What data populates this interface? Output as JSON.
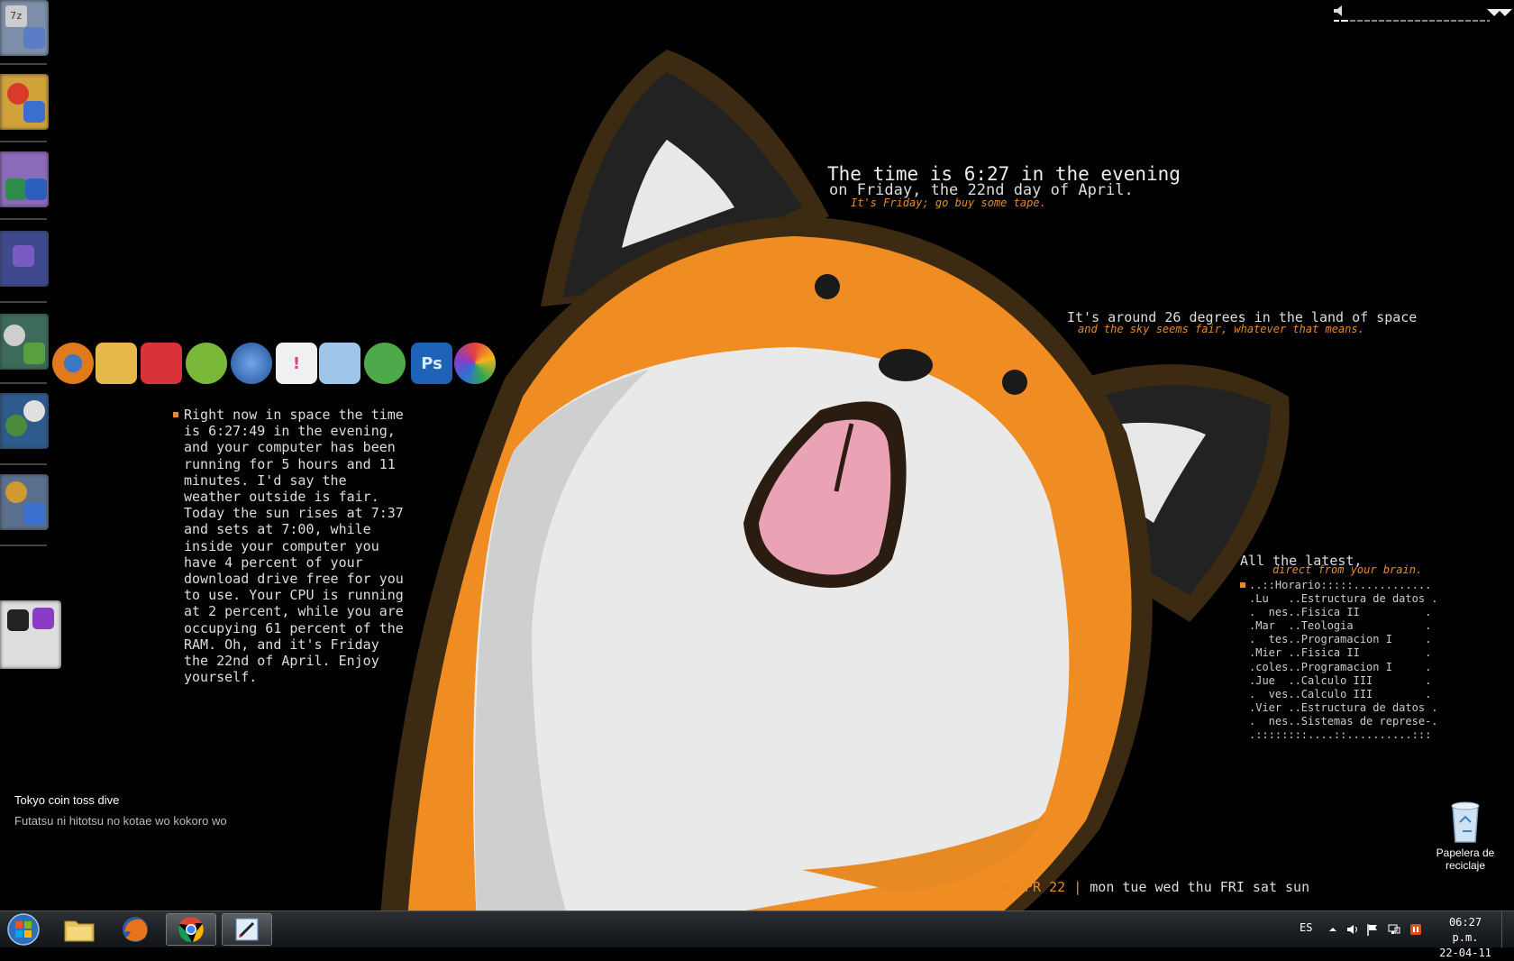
{
  "clock": {
    "line1": "The time is 6:27 in the evening",
    "line2": "on Friday, the 22nd day of April.",
    "quote": "It's Friday; go buy some tape."
  },
  "weather": {
    "line1": "It's around 26 degrees in the land of space",
    "line2": "and the sky seems fair, whatever that means."
  },
  "paragraph": "Right now in space the time is 6:27:49 in the evening, and your computer has been running for 5 hours and 11 minutes. I'd say the weather outside is fair. Today the sun rises at 7:37 and sets at 7:00, while inside your computer you have 4 percent of your download drive free for you to use. Your CPU is running at 2 percent, while you are occupying 61 percent of the RAM. Oh, and it's Friday the 22nd of April. Enjoy yourself.",
  "latest": {
    "title": "All the latest,",
    "subtitle": "direct from your brain.",
    "schedule": [
      "..::Horario:::::............",
      ".Lu   ..Estructura de datos .",
      ".  nes..Fisica II          .",
      ".Mar  ..Teologia           .",
      ".  tes..Programacion I     .",
      ".Mier ..Fisica II          .",
      ".coles..Programacion I     .",
      ".Jue  ..Calculo III        .",
      ".  ves..Calculo III        .",
      ".Vier ..Estructura de datos .",
      ".  nes..Sistemas de represe-.",
      ".::::::::....::..........:::"
    ]
  },
  "calendar": {
    "date": "APR 22",
    "separator": " | ",
    "days": "mon tue wed thu FRI sat sun"
  },
  "song": {
    "title": "Tokyo coin toss dive",
    "lyric": "Futatsu ni hitotsu no kotae wo kokoro wo"
  },
  "recycle_bin": {
    "label_line1": "Papelera de",
    "label_line2": "reciclaje"
  },
  "tray": {
    "language": "ES",
    "time": "06:27 p.m.",
    "date": "22-04-11"
  },
  "fan_icons": [
    "blender-icon",
    "folder-tool-icon",
    "camera-icon",
    "pen-icon",
    "messenger-icon",
    "notes-icon",
    "paint-icon",
    "search-tool-icon",
    "photoshop-icon",
    "picasa-icon"
  ],
  "fan_labels": {
    "photoshop": "Ps"
  },
  "dock_top_label": "7z",
  "colors": {
    "accent": "#e58a2a",
    "fox_orange": "#ef8c22",
    "fox_outline": "#3c2a12"
  }
}
